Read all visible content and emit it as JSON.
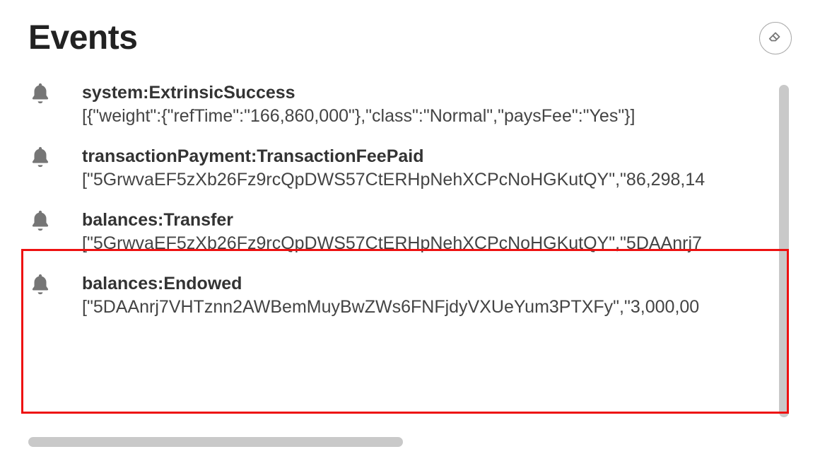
{
  "title": "Events",
  "clear_icon": "eraser-icon",
  "events": [
    {
      "name": "system:ExtrinsicSuccess",
      "details": "[{\"weight\":{\"refTime\":\"166,860,000\"},\"class\":\"Normal\",\"paysFee\":\"Yes\"}]"
    },
    {
      "name": "transactionPayment:TransactionFeePaid",
      "details": "[\"5GrwvaEF5zXb26Fz9rcQpDWS57CtERHpNehXCPcNoHGKutQY\",\"86,298,14"
    },
    {
      "name": "balances:Transfer",
      "details": "[\"5GrwvaEF5zXb26Fz9rcQpDWS57CtERHpNehXCPcNoHGKutQY\",\"5DAAnrj7"
    },
    {
      "name": "balances:Endowed",
      "details": "[\"5DAAnrj7VHTznn2AWBemMuyBwZWs6FNFjdyVXUeYum3PTXFy\",\"3,000,00"
    }
  ]
}
